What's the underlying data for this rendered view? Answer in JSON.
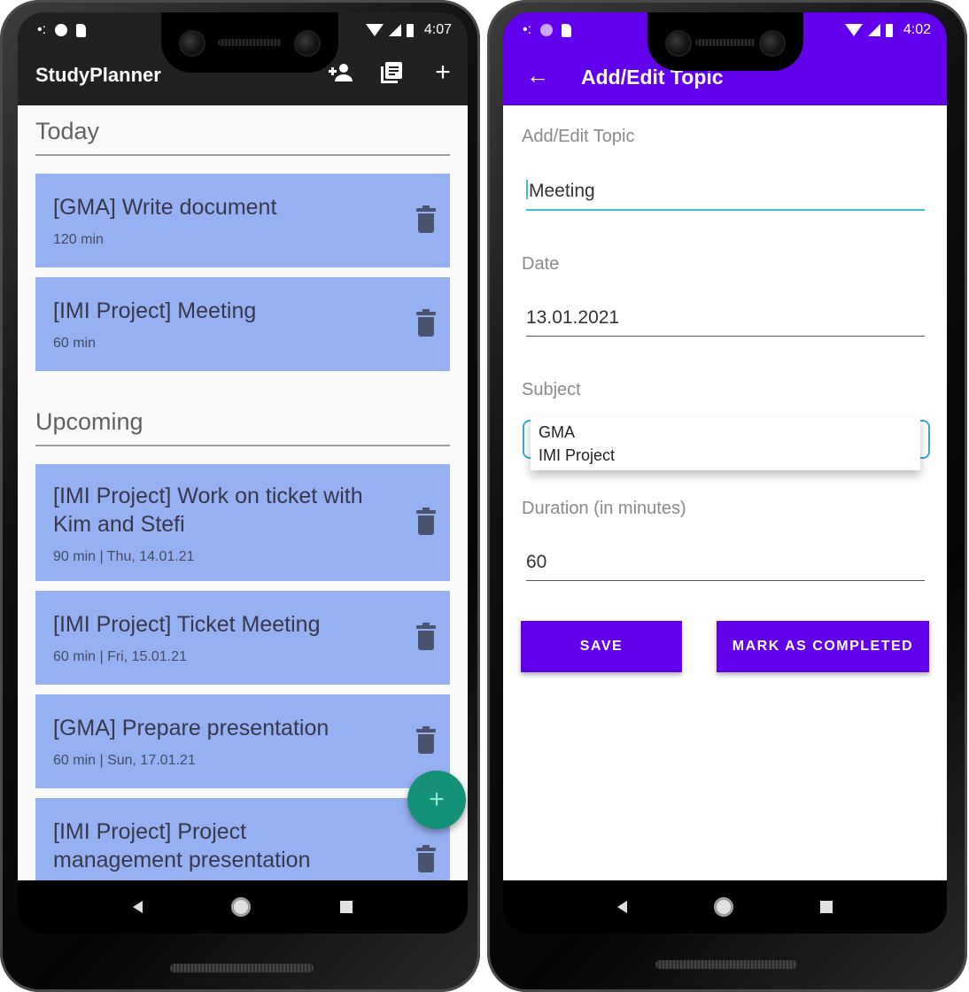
{
  "left_phone": {
    "status": {
      "time": "4:07"
    },
    "appbar": {
      "title": "StudyPlanner",
      "actions": [
        {
          "icon": "add-person-icon"
        },
        {
          "icon": "library-books-icon"
        },
        {
          "icon": "add-icon",
          "label": "+"
        }
      ]
    },
    "sections": {
      "today": {
        "heading": "Today",
        "items": [
          {
            "title": "[GMA] Write document",
            "subtitle": "120 min"
          },
          {
            "title": "[IMI Project] Meeting",
            "subtitle": "60 min"
          }
        ]
      },
      "upcoming": {
        "heading": "Upcoming",
        "items": [
          {
            "title": "[IMI Project] Work on ticket with Kim and Stefi",
            "subtitle": "90 min | Thu, 14.01.21"
          },
          {
            "title": "[IMI Project] Ticket Meeting",
            "subtitle": "60 min | Fri, 15.01.21"
          },
          {
            "title": "[GMA] Prepare presentation",
            "subtitle": "60 min | Sun, 17.01.21"
          },
          {
            "title": "[IMI Project] Project management presentation",
            "subtitle": ""
          }
        ]
      }
    },
    "fab": {
      "label": "+"
    },
    "colors": {
      "appbar": "#212121",
      "card": "#96b1f2",
      "fab": "#15917a"
    }
  },
  "right_phone": {
    "status": {
      "time": "4:02"
    },
    "appbar": {
      "back_icon": "arrow-back-icon",
      "back_label": "←",
      "title": "Add/Edit Topic"
    },
    "form": {
      "heading": "Add/Edit Topic",
      "topic_value": "Meeting",
      "date_label": "Date",
      "date_value": "13.01.2021",
      "subject_label": "Subject",
      "subject_options": [
        "GMA",
        "IMI Project"
      ],
      "duration_label": "Duration (in minutes)",
      "duration_value": "60"
    },
    "buttons": {
      "save": "SAVE",
      "complete": "MARK AS COMPLETED"
    },
    "colors": {
      "appbar": "#6200ee",
      "accent": "#3fc1c9"
    }
  }
}
